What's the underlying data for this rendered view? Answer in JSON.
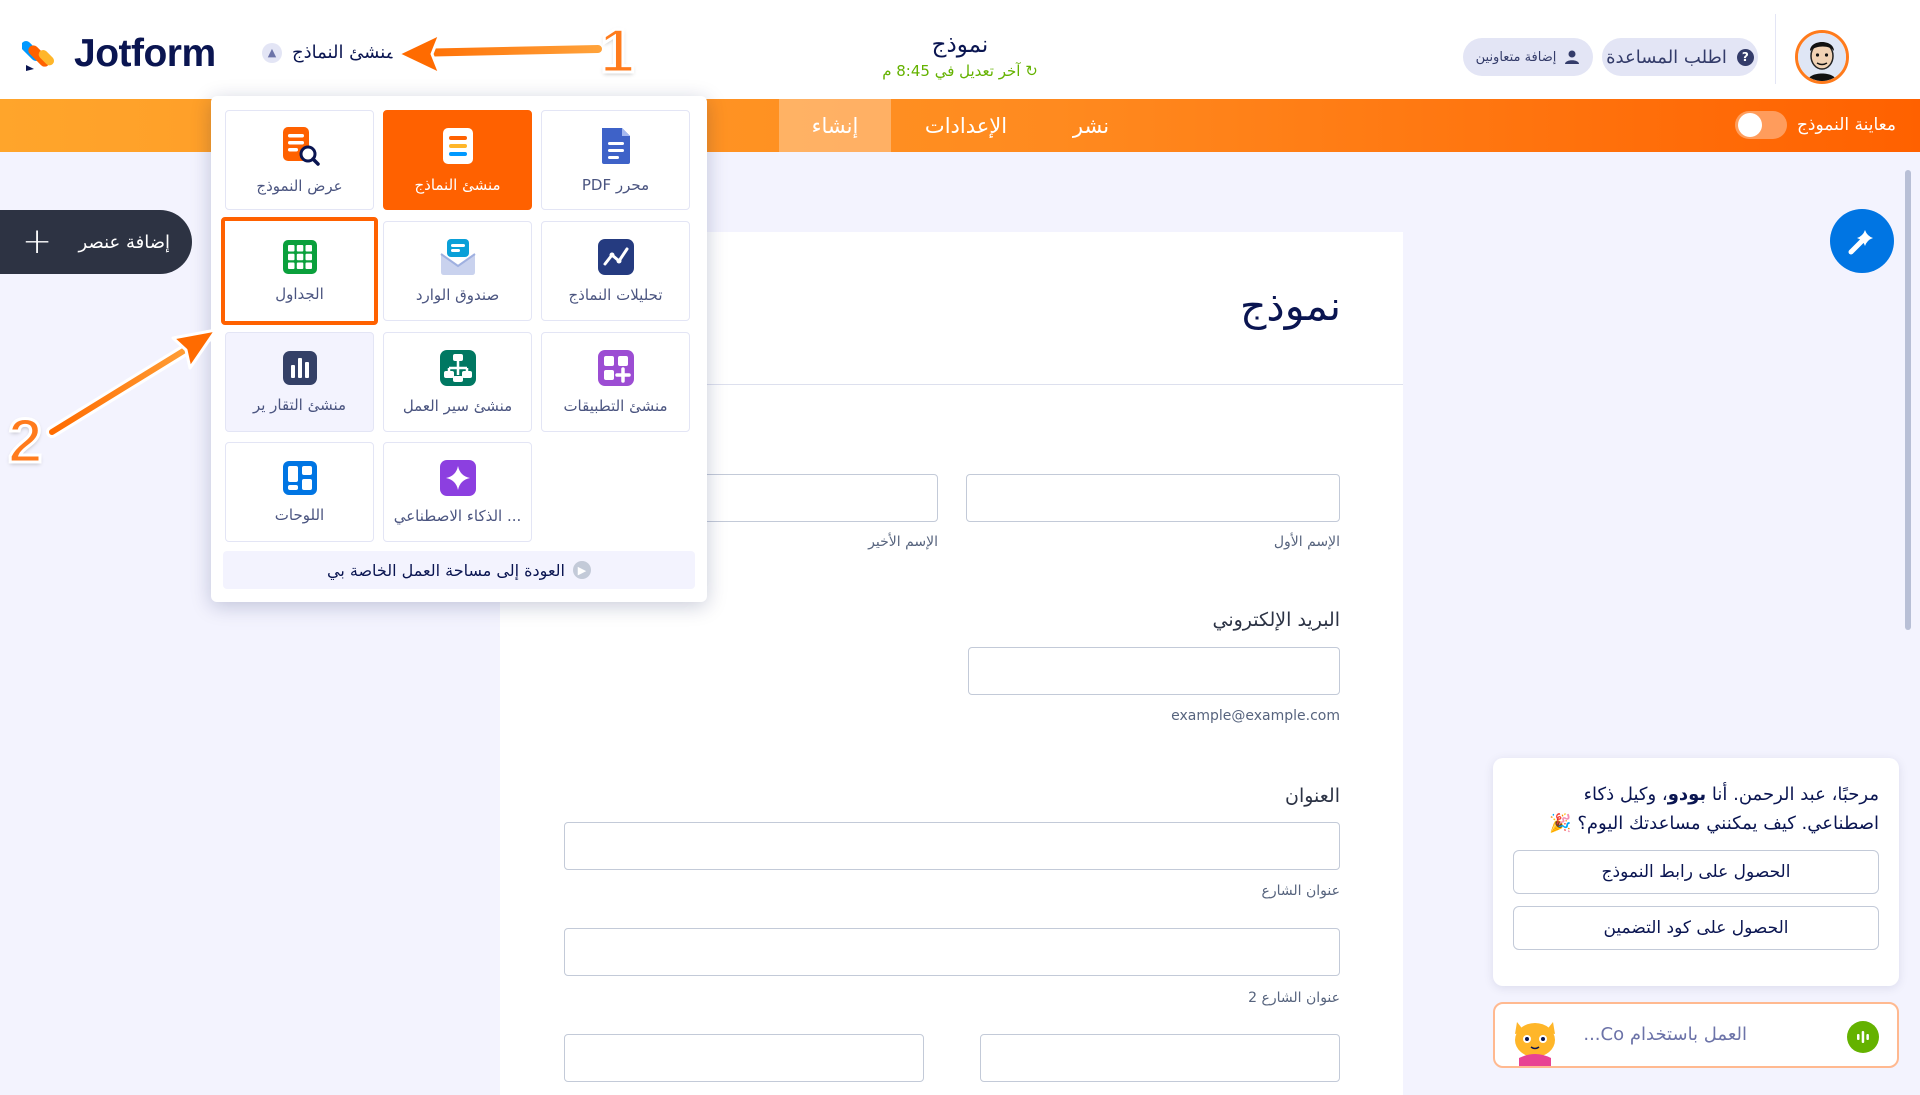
{
  "header": {
    "logo_text": "Jotform",
    "builder_switch": "منشئ النماذج",
    "form_title": "نموذج",
    "last_edit": "آخر تعديل في 8:45 م",
    "help_button": "اطلب المساعدة",
    "collaborators_button": "إضافة متعاونين"
  },
  "navbar": {
    "tabs": [
      {
        "label": "إنشاء",
        "active": true
      },
      {
        "label": "الإعدادات",
        "active": false
      },
      {
        "label": "نشر",
        "active": false
      }
    ],
    "preview_label": "معاينة النموذج"
  },
  "sidebar": {
    "add_element": "إضافة عنصر"
  },
  "dropdown": {
    "tiles": [
      {
        "label": "محرر PDF",
        "icon": "pdf-doc-icon"
      },
      {
        "label": "منشئ النماذج",
        "icon": "form-builder-icon"
      },
      {
        "label": "عرض النموذج",
        "icon": "form-view-icon"
      },
      {
        "label": "تحليلات النماذج",
        "icon": "analytics-icon"
      },
      {
        "label": "صندوق الوارد",
        "icon": "inbox-icon"
      },
      {
        "label": "الجداول",
        "icon": "tables-grid-icon"
      },
      {
        "label": "منشئ التطبيقات",
        "icon": "apps-icon"
      },
      {
        "label": "منشئ سير العمل",
        "icon": "workflow-icon"
      },
      {
        "label": "منشئ التقار ير",
        "icon": "report-icon"
      },
      {
        "label": "... الذكاء الاصطناعي",
        "icon": "ai-sparkle-icon"
      },
      {
        "label": "اللوحات",
        "icon": "boards-icon"
      }
    ],
    "back_to_workspace": "العودة إلى مساحة العمل الخاصة بي"
  },
  "form": {
    "heading": "نموذج",
    "first_name_sub": "الإسم الأول",
    "last_name_sub": "الإسم الأخير",
    "email_label": "البريد الإلكتروني",
    "email_sub": "example@example.com",
    "address_label": "العنوان",
    "street_sub": "عنوان الشارع",
    "street2_sub": "عنوان الشارع 2"
  },
  "chat": {
    "greeting_before": "مرحبًا، عبد الرحمن. أنا ",
    "agent_name": "بودو",
    "greeting_after": "، وكيل ذكاء اصطناعي. كيف يمكنني مساعدتك اليوم؟ 🎉",
    "button_link": "الحصول على رابط النموذج",
    "button_embed": "الحصول على كود التضمين",
    "input_placeholder": "العمل باستخدام Co..."
  },
  "annotations": {
    "step1": "1",
    "step2": "2"
  },
  "colors": {
    "brand_orange": "#ff6100",
    "navy": "#0a1551",
    "ai_blue": "#0075e3",
    "green": "#64b200"
  }
}
